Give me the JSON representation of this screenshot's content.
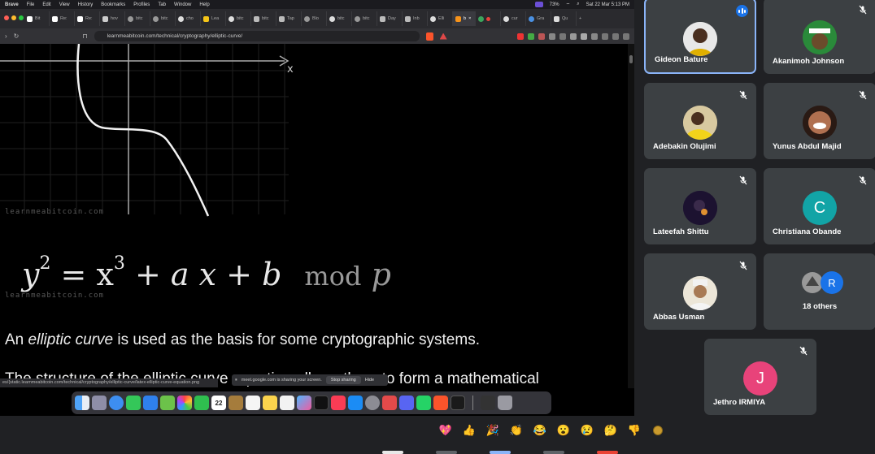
{
  "menubar": {
    "app": "Brave",
    "items": [
      "File",
      "Edit",
      "View",
      "History",
      "Bookmarks",
      "Profiles",
      "Tab",
      "Window",
      "Help"
    ],
    "battery": "73%",
    "datetime": "Sat 22 Mar  5:13 PM"
  },
  "tabs": [
    "Bit",
    "Re:",
    "Re:",
    "hov",
    "bitc",
    "bitc",
    "cho",
    "Lea",
    "bitc",
    "bitc",
    "Tap",
    "Blo",
    "bitc",
    "bitc",
    "Day",
    "Inb",
    "Elli",
    "b",
    "cur",
    "Gra",
    "Qu"
  ],
  "address": {
    "url": "learnmeabitcoin.com/technical/cryptography/elliptic-curve/"
  },
  "page": {
    "axis_x_label": "x",
    "watermark1": "learnmeabitcoin.com",
    "watermark2": "learnmeabitcoin.com",
    "equation": {
      "y": "y",
      "y_exp": "2",
      "eq": " = x",
      "x_exp": "3",
      "rest": " + a x + b",
      "mod": "mod",
      "p": " p"
    },
    "para1": {
      "before": "An ",
      "em": "elliptic curve",
      "after": " is used as the basis for some cryptographic systems."
    },
    "para2": "The structure of the elliptic curve equation allows them to form a mathematical"
  },
  "status_url": "es/{static.learnmeabitcoin.com/technical/cryptography/elliptic-curve/latex-elliptic-curve-equation.png",
  "sharebar": {
    "text": "meet.google.com is sharing your screen.",
    "stop": "Stop sharing",
    "hide": "Hide"
  },
  "dock": {
    "calendar_day": "22"
  },
  "participants": [
    {
      "name": "Gideon Bature",
      "speaking": true
    },
    {
      "name": "Akanimoh Johnson",
      "muted": true
    },
    {
      "name": "Adebakin Olujimi",
      "muted": true
    },
    {
      "name": "Yunus Abdul Majid",
      "muted": true
    },
    {
      "name": "Lateefah Shittu",
      "muted": true
    },
    {
      "name": "Christiana Obande",
      "muted": true,
      "initial": "C"
    },
    {
      "name": "Abbas Usman",
      "muted": true
    },
    {
      "others_label": "18 others",
      "initial": "R"
    },
    {
      "name": "Jethro IRMIYA",
      "muted": true,
      "initial": "J"
    }
  ],
  "colors": {
    "meet_bg": "#202124",
    "tile_bg": "#3c4043",
    "speaking_border": "#8ab4f8",
    "christiana_avatar": "#12a4a6",
    "jethro_avatar": "#e8437a",
    "others_avatar": "#1a73e8"
  },
  "reactions": [
    "sparkling-heart",
    "thumbs-up",
    "party-popper",
    "clapping-hands",
    "tears-of-joy",
    "surprised",
    "sad",
    "thinking",
    "thumbs-down",
    "more"
  ]
}
